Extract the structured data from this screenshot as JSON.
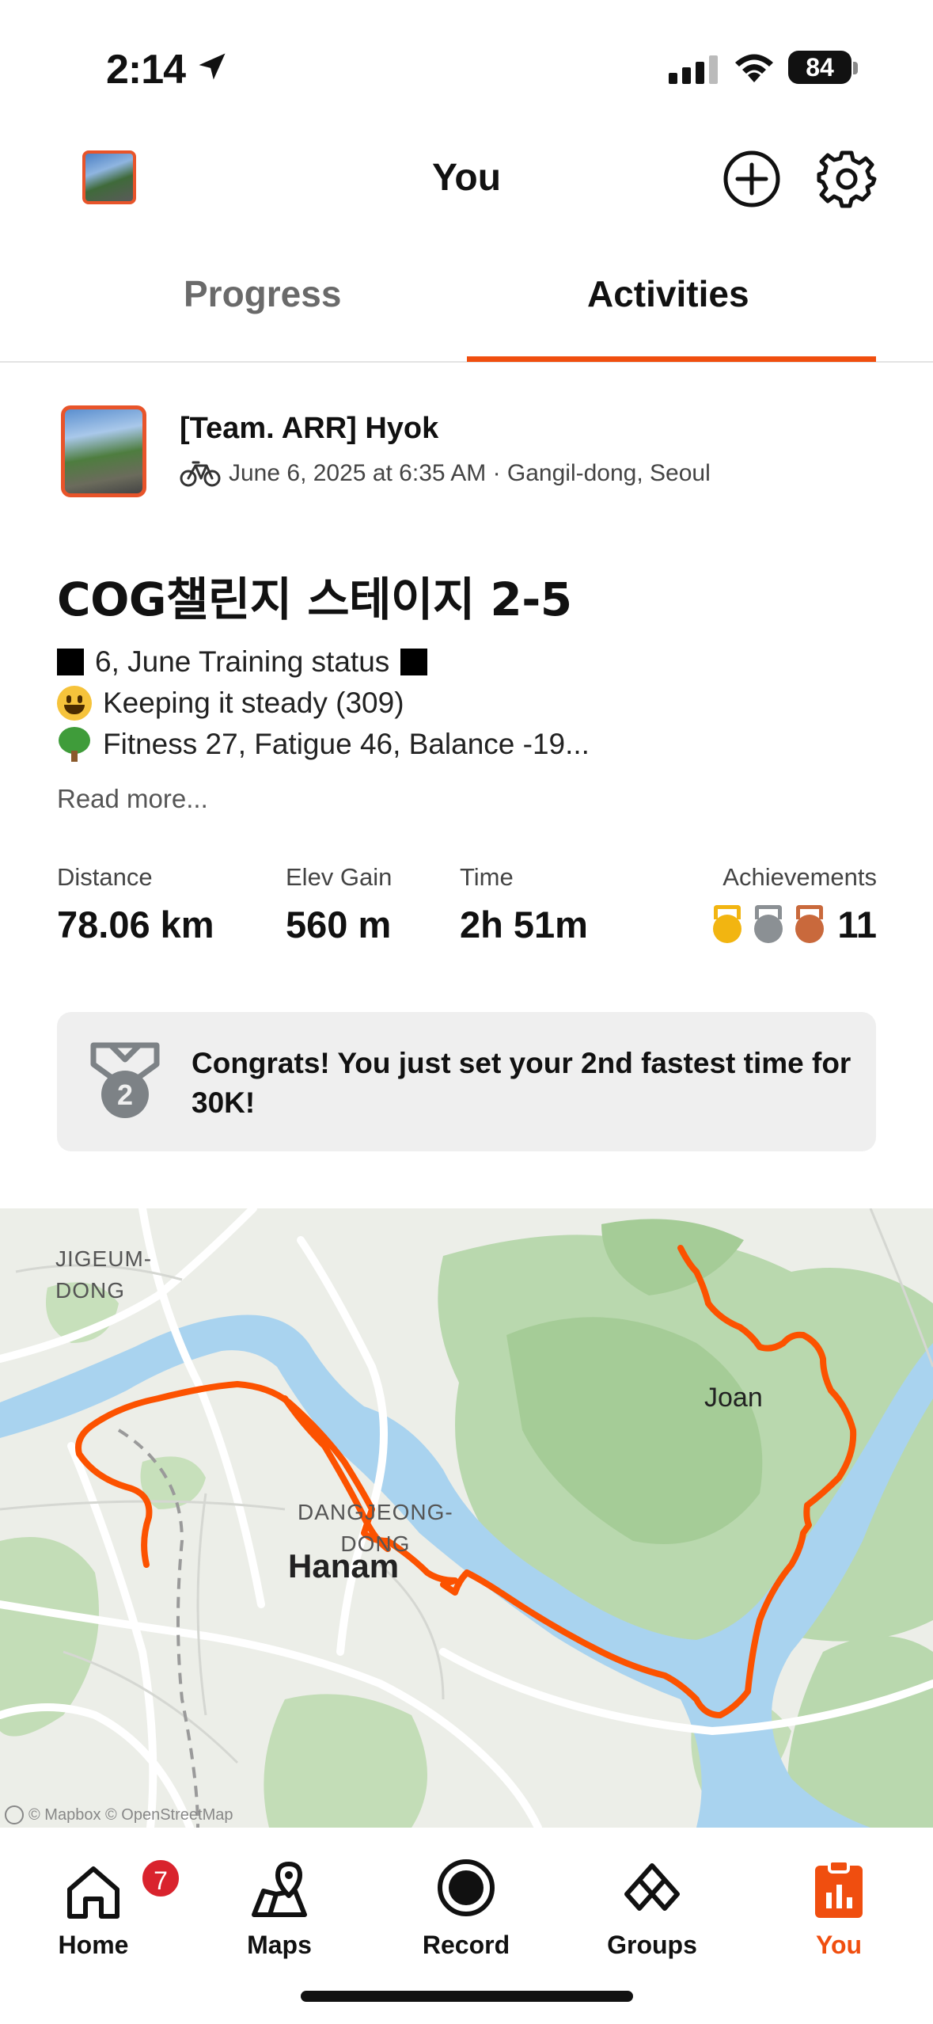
{
  "status_bar": {
    "time": "2:14",
    "battery": "84"
  },
  "header": {
    "title": "You"
  },
  "tabs": [
    {
      "label": "Progress",
      "active": false
    },
    {
      "label": "Activities",
      "active": true
    }
  ],
  "activity": {
    "athlete": "[Team. ARR] Hyok",
    "meta": "June 6, 2025 at 6:35 AM · Gangil-dong, Seoul",
    "sport_icon": "bike-icon",
    "title": "COG챌린지 스테이지 2-5",
    "description": [
      {
        "icon": "black-square",
        "text": "6, June Training status",
        "trail_icon": "black-square"
      },
      {
        "icon": "smiley-emoji",
        "text": "Keeping it steady (309)"
      },
      {
        "icon": "tree-emoji",
        "text": "Fitness 27, Fatigue 46, Balance -19..."
      }
    ],
    "read_more": "Read more...",
    "stats": {
      "distance": {
        "label": "Distance",
        "value": "78.06 km"
      },
      "elev": {
        "label": "Elev Gain",
        "value": "560 m"
      },
      "time": {
        "label": "Time",
        "value": "2h 51m"
      },
      "achievements": {
        "label": "Achievements",
        "value": "11"
      }
    },
    "congrats": {
      "text": "Congrats! You just set your 2nd fastest time for 30K!",
      "medal_rank": "2"
    }
  },
  "map": {
    "labels": {
      "jigeum": "JIGEUM-\nDONG",
      "dangjeong": "DANGJEONG-\nDONG",
      "hanam": "Hanam",
      "joan": "Joan"
    },
    "attribution": "© Mapbox © OpenStreetMap",
    "route_color": "#fc5200",
    "water_color": "#a9d3ef"
  },
  "tabbar": {
    "home": {
      "label": "Home",
      "badge": "7"
    },
    "maps": {
      "label": "Maps"
    },
    "record": {
      "label": "Record"
    },
    "groups": {
      "label": "Groups"
    },
    "you": {
      "label": "You",
      "active": true
    }
  },
  "colors": {
    "accent": "#f04e0f"
  }
}
